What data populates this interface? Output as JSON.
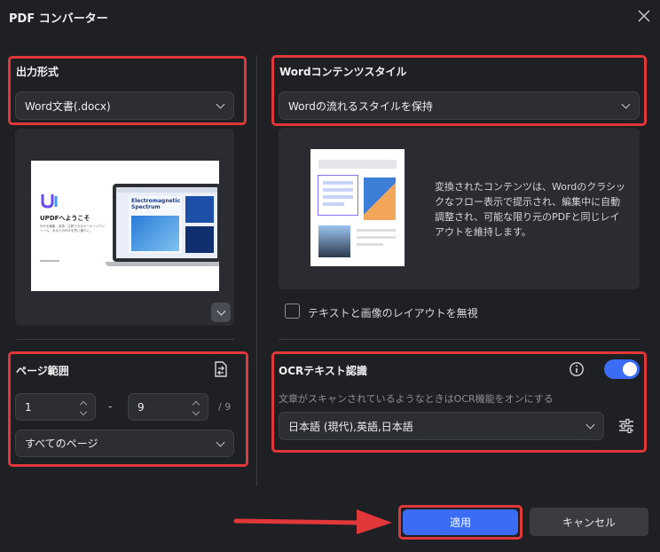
{
  "window": {
    "title": "PDF コンバーター"
  },
  "output_format": {
    "label": "出力形式",
    "selected": "Word文書(.docx)"
  },
  "preview": {
    "logo_text": "UPDFへようこそ",
    "tagline": "PDFを編集・変換・注釈できるオールインワンツール。あなたのPDFを思い通りに。",
    "screen_text": "Electromagnetic Spectrum"
  },
  "page_range": {
    "label": "ページ範囲",
    "from": "1",
    "dash": "-",
    "to": "9",
    "total": "/ 9",
    "scope": "すべてのページ"
  },
  "word_style": {
    "label": "Wordコンテンツスタイル",
    "selected": "Wordの流れるスタイルを保持",
    "description": "変換されたコンテンツは、Wordのクラシックなフロー表示で提示され、編集中に自動調整され、可能な限り元のPDFと同じレイアウトを維持します。"
  },
  "ignore_layout": {
    "label": "テキストと画像のレイアウトを無視",
    "checked": false
  },
  "ocr": {
    "label": "OCRテキスト認識",
    "enabled": true,
    "hint": "文章がスキャンされているようなときはOCR機能をオンにする",
    "language": "日本語 (現代),英語,日本語"
  },
  "buttons": {
    "apply": "適用",
    "cancel": "キャンセル"
  },
  "colors": {
    "accent": "#3b6cf4",
    "highlight": "#e0373a",
    "background": "#1f2024"
  }
}
